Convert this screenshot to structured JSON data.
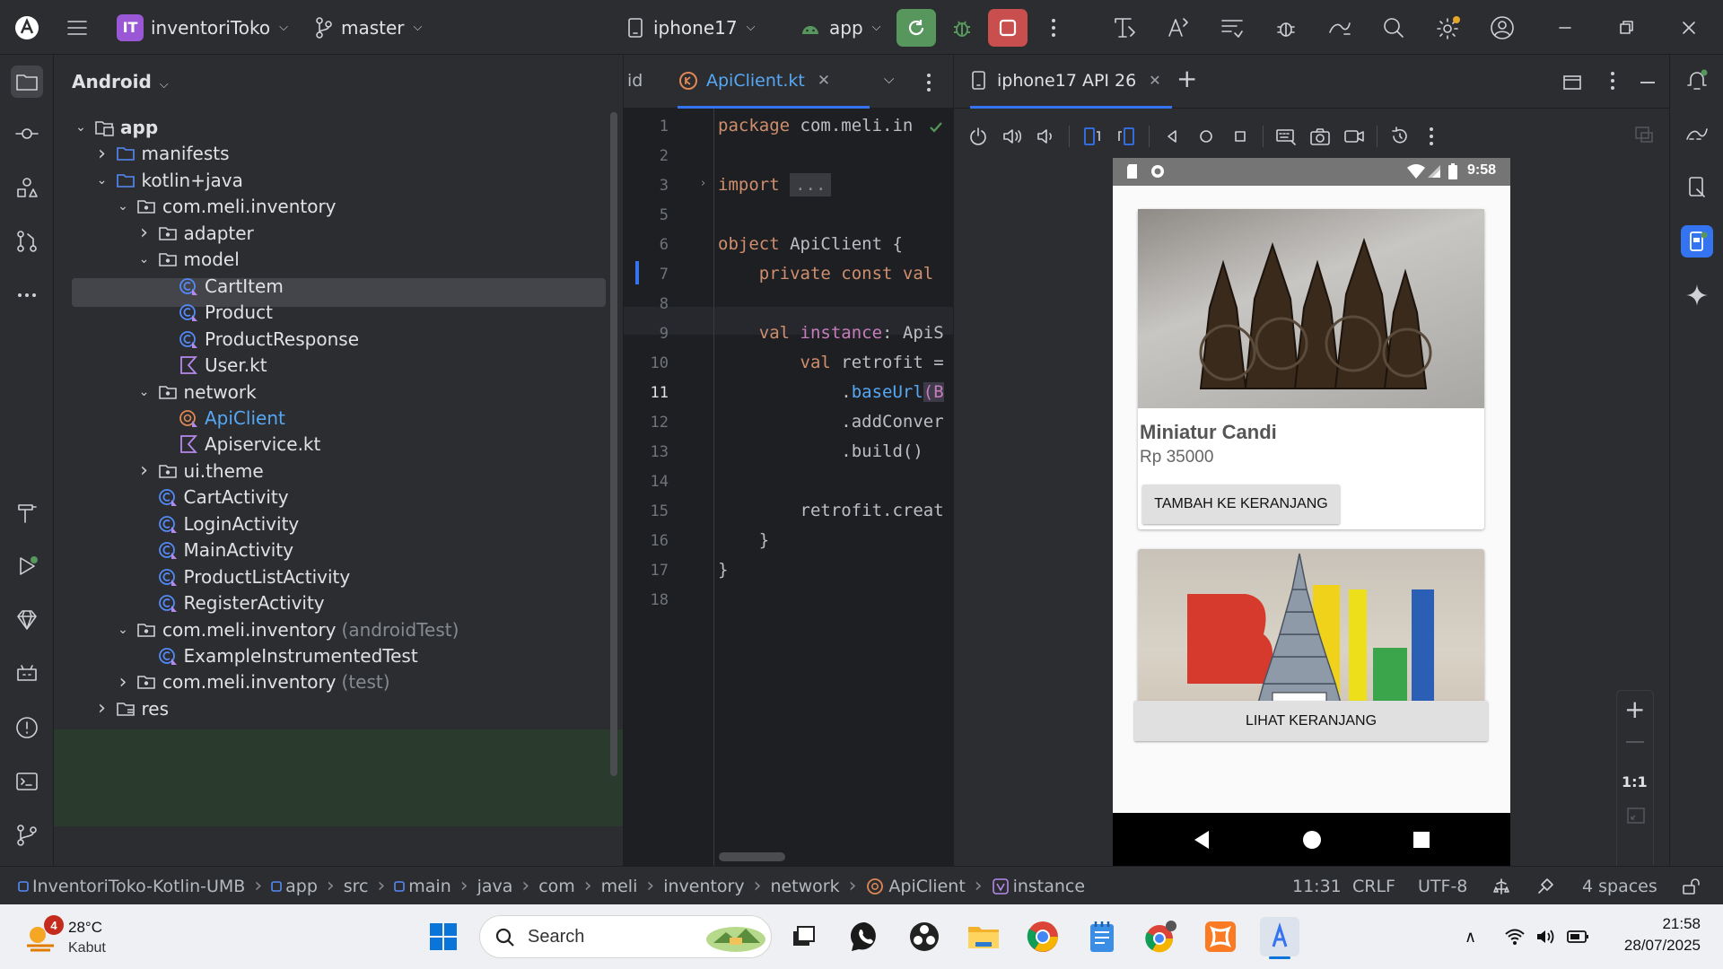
{
  "titlebar": {
    "project_name": "inventoriToko",
    "project_badge": "IT",
    "branch": "master",
    "device": "iphone17",
    "run_config": "app"
  },
  "project_panel": {
    "header": "Android",
    "tree": [
      {
        "label": "app",
        "bold": true
      },
      {
        "label": "manifests"
      },
      {
        "label": "kotlin+java"
      },
      {
        "label": "com.meli.inventory"
      },
      {
        "label": "adapter"
      },
      {
        "label": "model"
      },
      {
        "label": "CartItem"
      },
      {
        "label": "Product"
      },
      {
        "label": "ProductResponse"
      },
      {
        "label": "User.kt"
      },
      {
        "label": "network"
      },
      {
        "label": "ApiClient"
      },
      {
        "label": "Apiservice.kt"
      },
      {
        "label": "ui.theme"
      },
      {
        "label": "CartActivity"
      },
      {
        "label": "LoginActivity"
      },
      {
        "label": "MainActivity"
      },
      {
        "label": "ProductListActivity"
      },
      {
        "label": "RegisterActivity"
      },
      {
        "label": "com.meli.inventory",
        "suffix": "(androidTest)"
      },
      {
        "label": "ExampleInstrumentedTest"
      },
      {
        "label": "com.meli.inventory",
        "suffix": "(test)"
      },
      {
        "label": "res"
      }
    ]
  },
  "editor": {
    "prev_tab_fragment": "id",
    "active_tab": "ApiClient.kt",
    "line_numbers": [
      "1",
      "2",
      "3",
      "5",
      "6",
      "7",
      "8",
      "9",
      "10",
      "11",
      "12",
      "13",
      "14",
      "15",
      "16",
      "17",
      "18"
    ],
    "code": {
      "l1a": "package",
      "l1b": " com.meli.in",
      "l3a": "import",
      "l3b": "...",
      "l6a": "object",
      "l6b": " ApiClient {",
      "l7a": "    private const val",
      "l9a": "    val",
      "l9b": " instance",
      "l9c": ": ApiS",
      "l10a": "        val",
      "l10b": " retrofit =",
      "l11a": "            .",
      "l11b": "baseUrl",
      "l11c": "(B",
      "l12a": "            .addConver",
      "l13a": "            .build()",
      "l15a": "        retrofit.creat",
      "l16a": "    }",
      "l17a": "}"
    }
  },
  "emulator": {
    "tab_label": "iphone17 API 26",
    "phone_time": "9:58",
    "product1_name": "Miniatur Candi",
    "product1_price": "Rp 35000",
    "add_to_cart": "TAMBAH KE KERANJANG",
    "view_cart": "LIHAT KERANJANG",
    "zoom_label": "1:1"
  },
  "statusbar": {
    "breadcrumbs": [
      "InventoriToko-Kotlin-UMB",
      "app",
      "src",
      "main",
      "java",
      "com",
      "meli",
      "inventory",
      "network",
      "ApiClient",
      "instance"
    ],
    "cursor": "11:31",
    "line_sep": "CRLF",
    "encoding": "UTF-8",
    "indent": "4 spaces"
  },
  "taskbar": {
    "weather_temp": "28°C",
    "weather_desc": "Kabut",
    "weather_badge": "4",
    "search_placeholder": "Search",
    "time": "21:58",
    "date": "28/07/2025"
  },
  "colors": {
    "accent": "#3574f0",
    "run_green": "#57965c",
    "stop_red": "#c94f4f",
    "project_badge": "#9a57d6"
  }
}
